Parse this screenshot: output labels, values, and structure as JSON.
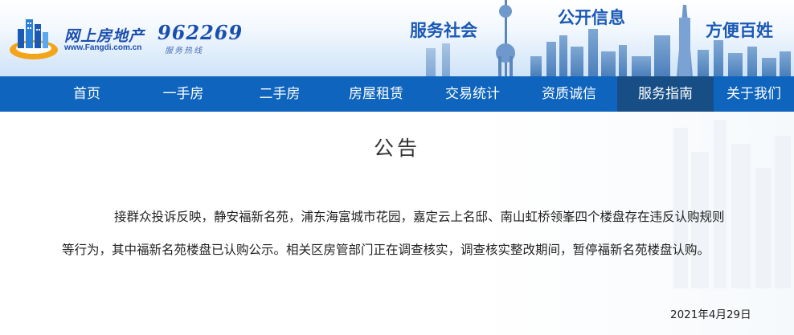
{
  "header": {
    "logo_cn": "网上房地产",
    "logo_url": "www.Fangdi.com.cn",
    "hotline_number": "962269",
    "hotline_label": "服务热线",
    "slogans": [
      "服务社会",
      "公开信息",
      "方便百姓"
    ]
  },
  "nav": {
    "items": [
      "首页",
      "一手房",
      "二手房",
      "房屋租赁",
      "交易统计",
      "资质诚信",
      "服务指南",
      "关于我们"
    ],
    "active": "服务指南"
  },
  "notice": {
    "title": "公告",
    "para_line1": "接群众投诉反映，静安福新名苑，浦东海富城市花园，嘉定云上名邸、南山虹桥领峯四个楼盘存在违反认购规则",
    "para_line2": "等行为，其中福新名苑楼盘已认购公示。相关区房管部门正在调查核实，调查核实整改期间，暂停福新名苑楼盘认购。",
    "date": "2021年4月29日"
  },
  "colors": {
    "nav_bg": "#0f64bd",
    "nav_active_bg": "#174e86",
    "brand_blue": "#1b59b5"
  }
}
